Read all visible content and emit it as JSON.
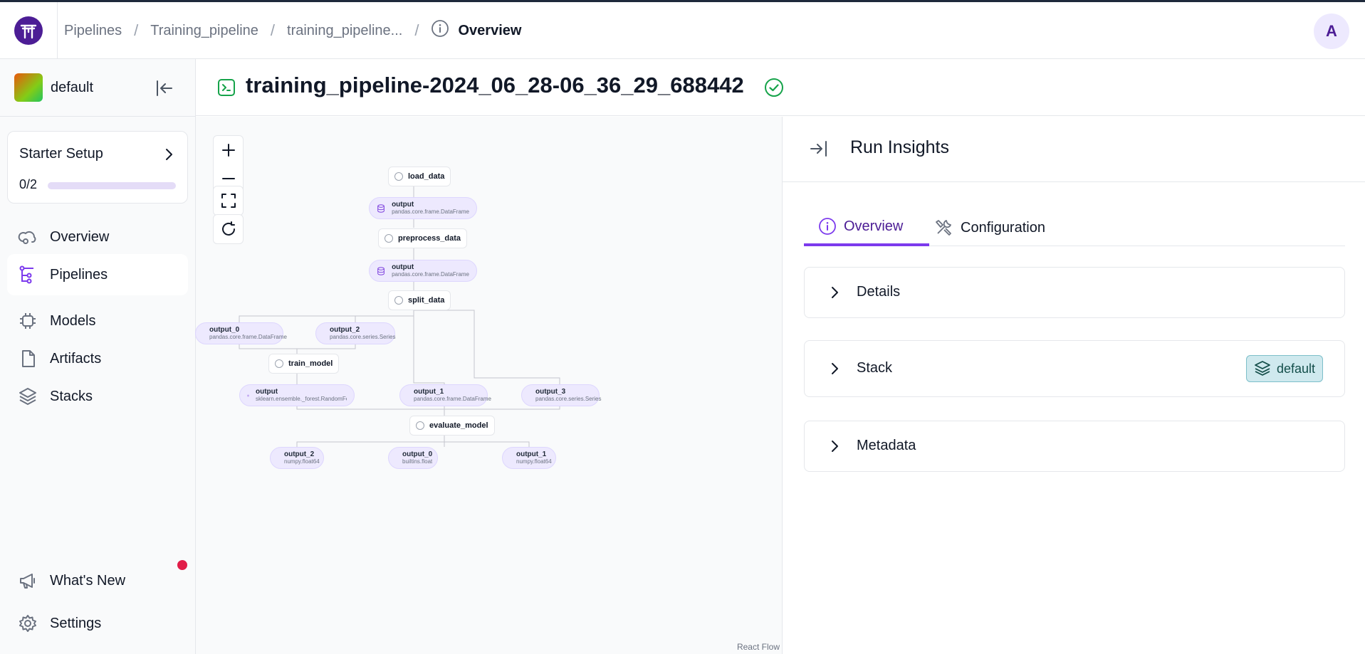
{
  "breadcrumbs": {
    "items": [
      "Pipelines",
      "Training_pipeline",
      "training_pipeline..."
    ],
    "current": "Overview"
  },
  "user": {
    "avatar_initial": "A"
  },
  "sidebar": {
    "workspace": "default",
    "starter": {
      "title": "Starter Setup",
      "progress_text": "0/2",
      "progress": 0.0
    },
    "items": [
      {
        "label": "Overview",
        "icon": "overview-icon"
      },
      {
        "label": "Pipelines",
        "icon": "pipelines-icon",
        "active": true
      },
      {
        "label": "Models",
        "icon": "models-icon"
      },
      {
        "label": "Artifacts",
        "icon": "artifacts-icon"
      },
      {
        "label": "Stacks",
        "icon": "stacks-icon"
      }
    ],
    "bottom": [
      {
        "label": "What's New",
        "icon": "megaphone-icon",
        "notification": true
      },
      {
        "label": "Settings",
        "icon": "gear-icon"
      }
    ]
  },
  "run": {
    "title": "training_pipeline-2024_06_28-06_36_29_688442",
    "status": "completed"
  },
  "dag": {
    "steps": [
      "load_data",
      "preprocess_data",
      "split_data",
      "train_model",
      "evaluate_model"
    ],
    "artifacts": {
      "load_output": {
        "name": "output",
        "type": "pandas.core.frame.DataFrame"
      },
      "preprocess_output": {
        "name": "output",
        "type": "pandas.core.frame.DataFrame"
      },
      "split_output_0": {
        "name": "output_0",
        "type": "pandas.core.frame.DataFrame"
      },
      "split_output_2": {
        "name": "output_2",
        "type": "pandas.core.series.Series"
      },
      "train_output": {
        "name": "output",
        "type": "sklearn.ensemble._forest.RandomForest..."
      },
      "split_output_1": {
        "name": "output_1",
        "type": "pandas.core.frame.DataFrame"
      },
      "split_output_3": {
        "name": "output_3",
        "type": "pandas.core.series.Series"
      },
      "eval_output_2": {
        "name": "output_2",
        "type": "numpy.float64"
      },
      "eval_output_0": {
        "name": "output_0",
        "type": "builtins.float"
      },
      "eval_output_1": {
        "name": "output_1",
        "type": "numpy.float64"
      }
    },
    "attribution": "React Flow"
  },
  "panel": {
    "title": "Run Insights",
    "tabs": [
      "Overview",
      "Configuration"
    ],
    "sections": [
      "Details",
      "Stack",
      "Metadata"
    ],
    "stack_badge": "default"
  },
  "colors": {
    "accent": "#7c3aed",
    "brand": "#4c1d95",
    "success": "#16a34a",
    "alert": "#e11d48"
  }
}
